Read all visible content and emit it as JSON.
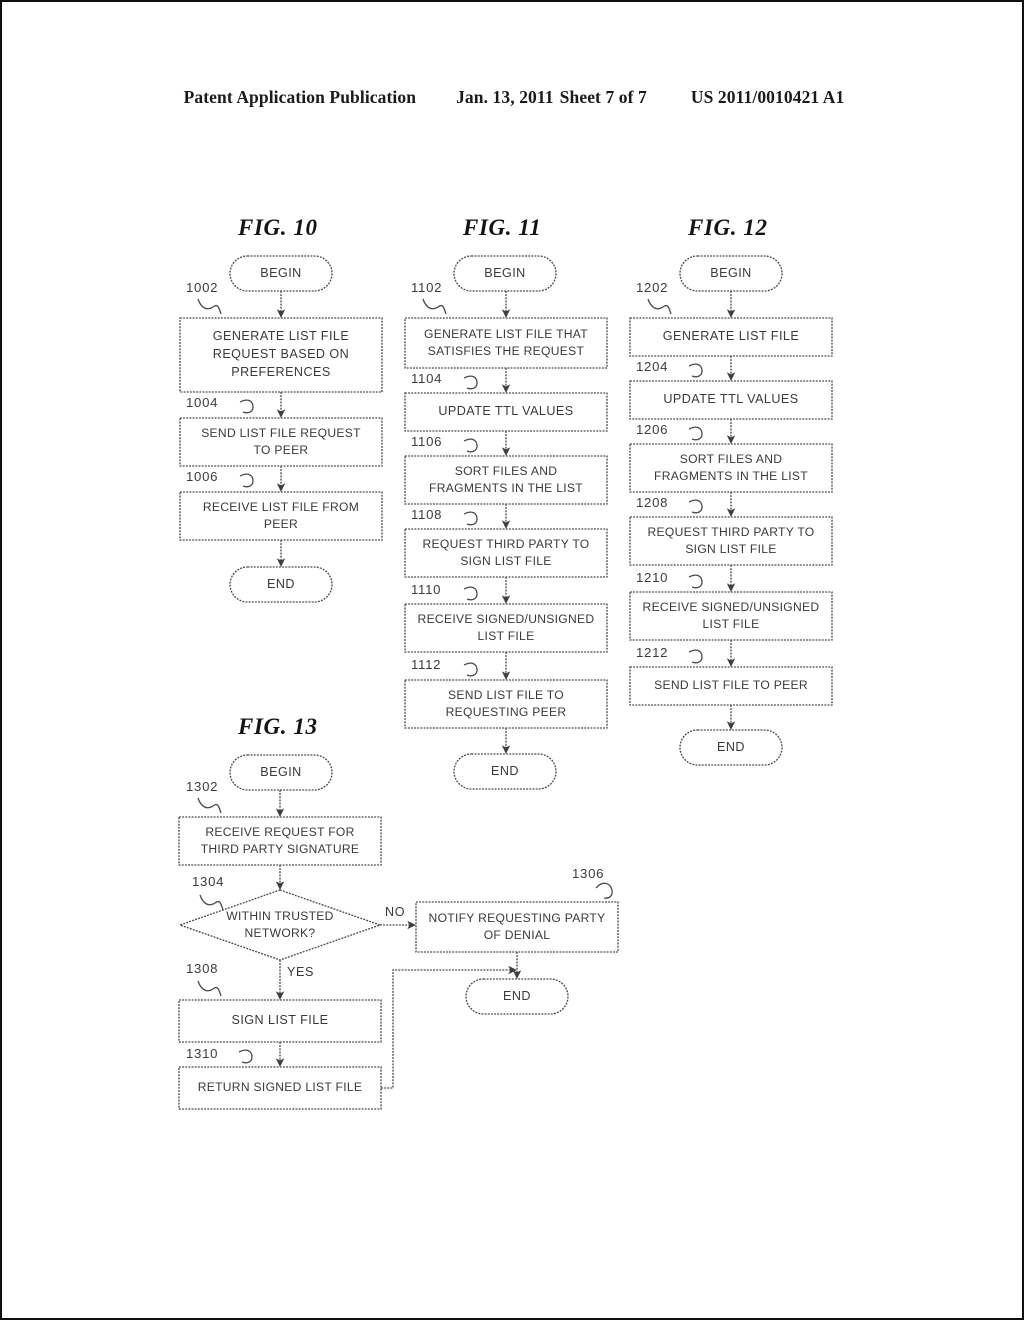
{
  "header": {
    "publication": "Patent Application Publication",
    "date": "Jan. 13, 2011",
    "sheet": "Sheet 7 of 7",
    "patent_number": "US 2011/0010421 A1"
  },
  "figures": [
    {
      "id": "fig10",
      "caption": "FIG. 10",
      "nodes": [
        {
          "ref": "",
          "type": "terminator",
          "text": "BEGIN"
        },
        {
          "ref": "1002",
          "type": "process",
          "text": "GENERATE LIST FILE\nREQUEST BASED ON\nPREFERENCES"
        },
        {
          "ref": "1004",
          "type": "process",
          "text": "SEND LIST FILE REQUEST\nTO PEER"
        },
        {
          "ref": "1006",
          "type": "process",
          "text": "RECEIVE LIST FILE FROM\nPEER"
        },
        {
          "ref": "",
          "type": "terminator",
          "text": "END"
        }
      ]
    },
    {
      "id": "fig11",
      "caption": "FIG. 11",
      "nodes": [
        {
          "ref": "",
          "type": "terminator",
          "text": "BEGIN"
        },
        {
          "ref": "1102",
          "type": "process",
          "text": "GENERATE LIST FILE THAT\nSATISFIES THE REQUEST"
        },
        {
          "ref": "1104",
          "type": "process",
          "text": "UPDATE TTL VALUES"
        },
        {
          "ref": "1106",
          "type": "process",
          "text": "SORT FILES AND\nFRAGMENTS IN THE LIST"
        },
        {
          "ref": "1108",
          "type": "process",
          "text": "REQUEST THIRD PARTY TO\nSIGN LIST FILE"
        },
        {
          "ref": "1110",
          "type": "process",
          "text": "RECEIVE SIGNED/UNSIGNED\nLIST FILE"
        },
        {
          "ref": "1112",
          "type": "process",
          "text": "SEND LIST FILE TO\nREQUESTING PEER"
        },
        {
          "ref": "",
          "type": "terminator",
          "text": "END"
        }
      ]
    },
    {
      "id": "fig12",
      "caption": "FIG. 12",
      "nodes": [
        {
          "ref": "",
          "type": "terminator",
          "text": "BEGIN"
        },
        {
          "ref": "1202",
          "type": "process",
          "text": "GENERATE LIST FILE"
        },
        {
          "ref": "1204",
          "type": "process",
          "text": "UPDATE TTL VALUES"
        },
        {
          "ref": "1206",
          "type": "process",
          "text": "SORT FILES AND\nFRAGMENTS IN THE LIST"
        },
        {
          "ref": "1208",
          "type": "process",
          "text": "REQUEST THIRD PARTY TO\nSIGN LIST FILE"
        },
        {
          "ref": "1210",
          "type": "process",
          "text": "RECEIVE SIGNED/UNSIGNED\nLIST FILE"
        },
        {
          "ref": "1212",
          "type": "process",
          "text": "SEND LIST FILE TO PEER"
        },
        {
          "ref": "",
          "type": "terminator",
          "text": "END"
        }
      ]
    },
    {
      "id": "fig13",
      "caption": "FIG. 13",
      "nodes": [
        {
          "ref": "",
          "type": "terminator",
          "text": "BEGIN"
        },
        {
          "ref": "1302",
          "type": "process",
          "text": "RECEIVE REQUEST FOR\nTHIRD PARTY SIGNATURE"
        },
        {
          "ref": "1304",
          "type": "decision",
          "text": "WITHIN TRUSTED\nNETWORK?"
        },
        {
          "ref": "1306",
          "type": "process",
          "text": "NOTIFY REQUESTING PARTY\nOF DENIAL"
        },
        {
          "ref": "1308",
          "type": "process",
          "text": "SIGN LIST FILE"
        },
        {
          "ref": "1310",
          "type": "process",
          "text": "RETURN SIGNED LIST FILE"
        },
        {
          "ref": "",
          "type": "terminator",
          "text": "END"
        }
      ],
      "branch_labels": {
        "no": "NO",
        "yes": "YES"
      }
    }
  ]
}
